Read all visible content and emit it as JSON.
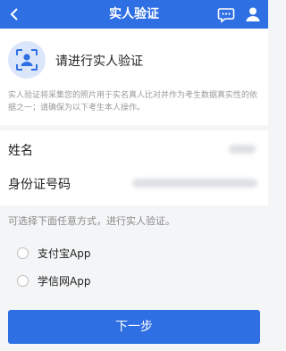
{
  "header": {
    "title": "实人验证",
    "back_icon": "chevron-left-icon",
    "chat_icon": "chat-bubble-icon",
    "user_icon": "user-icon",
    "background_color": "#2f6fe4"
  },
  "intro": {
    "icon": "face-id-icon",
    "title": "请进行实人验证",
    "description": "实人验证将采集您的照片用于实名真人比对并作为考生数据真实性的依据之一；请确保为以下考生本人操作。"
  },
  "form": {
    "name_label": "姓名",
    "id_label": "身份证号码"
  },
  "method_hint": "可选择下面任意方式，进行实人验证。",
  "options": [
    {
      "label": "支付宝App"
    },
    {
      "label": "学信网App"
    }
  ],
  "next_button": "下一步",
  "accent_color": "#2f6fe4"
}
